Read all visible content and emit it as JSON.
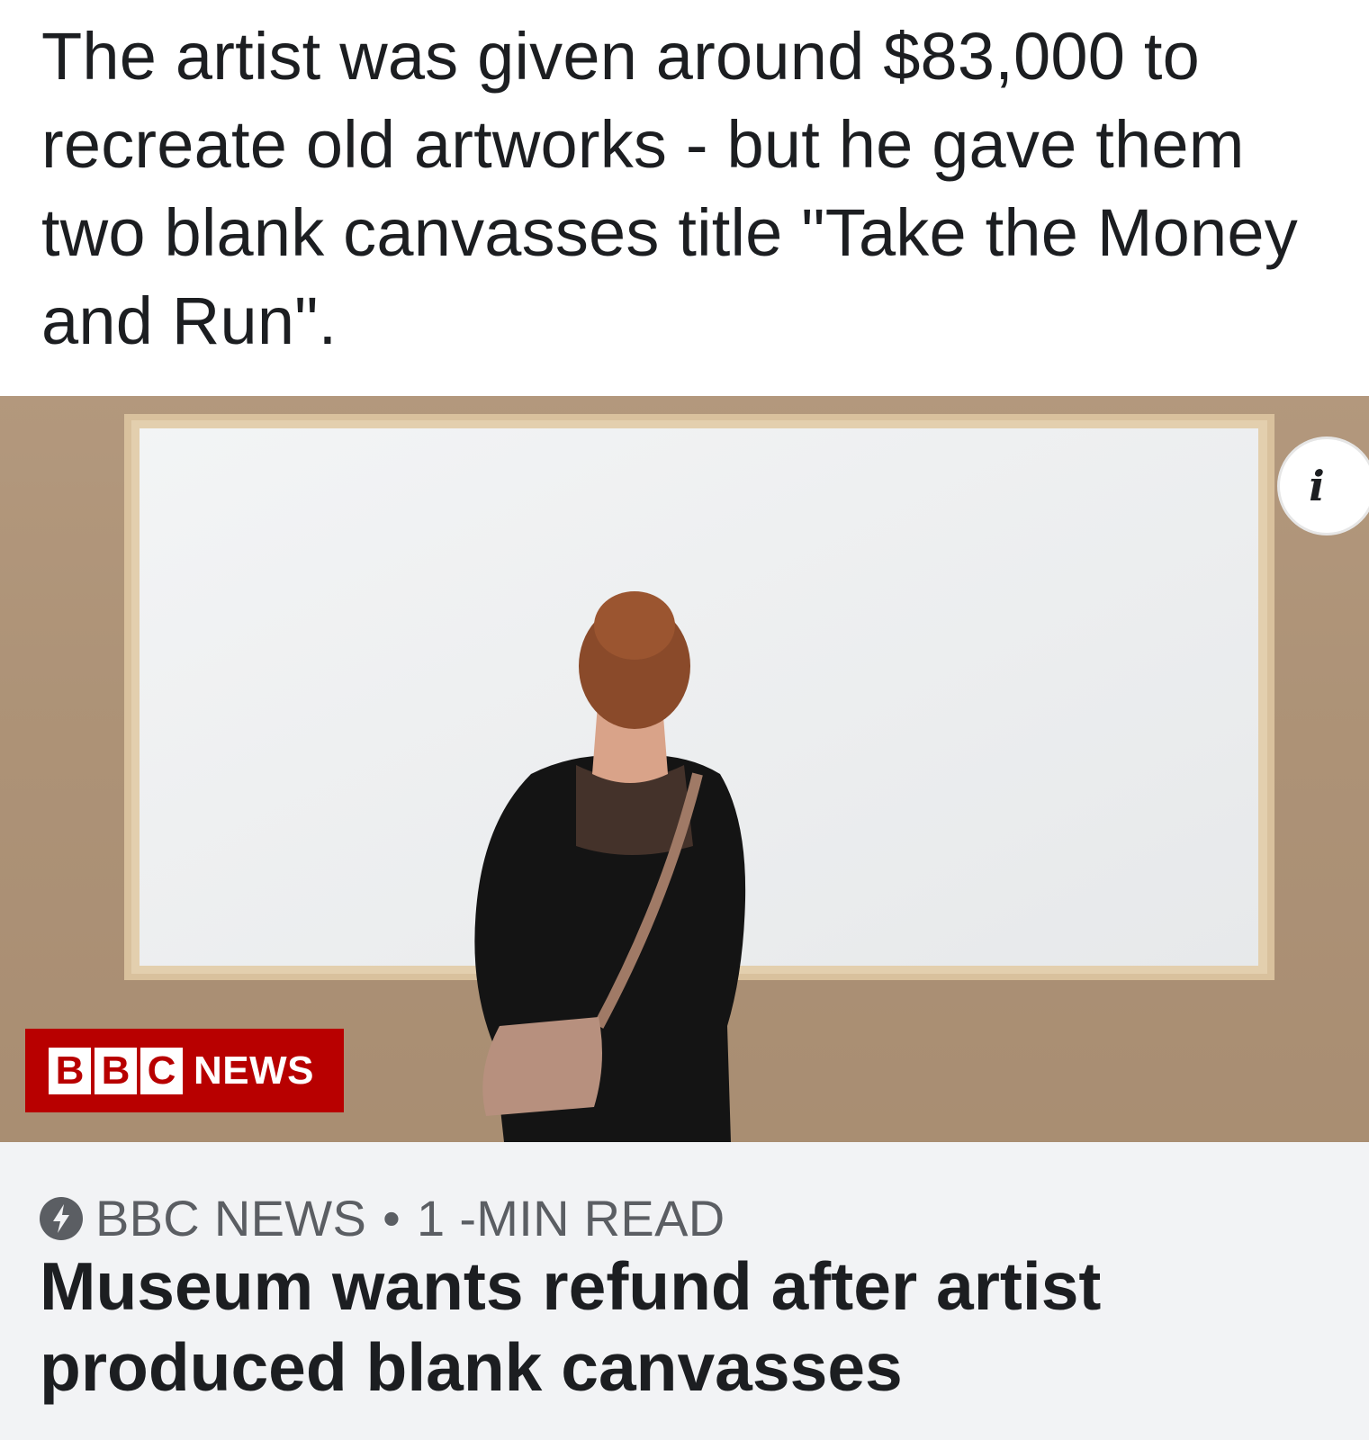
{
  "post": {
    "text": "The artist was given around $83,000 to recreate old artworks - but he gave them two blank canvasses title \"Take the Money and Run\"."
  },
  "photo": {
    "watermark_brand": [
      "B",
      "B",
      "C"
    ],
    "watermark_word": "NEWS",
    "info_icon_glyph": "i",
    "brand_color": "#b80000"
  },
  "preview": {
    "source": "BBC NEWS",
    "separator": "•",
    "read_time": "1 -MIN READ",
    "headline": "Museum wants refund after artist produced blank canvasses",
    "source_icon": "lightning-bolt-icon"
  }
}
